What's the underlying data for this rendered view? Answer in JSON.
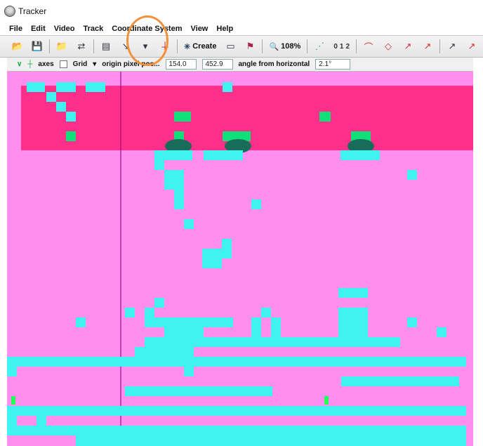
{
  "window": {
    "title": "Tracker"
  },
  "menu": [
    "File",
    "Edit",
    "Video",
    "Track",
    "Coordinate System",
    "View",
    "Help"
  ],
  "toolbar": {
    "create_label": "Create",
    "zoom_label": "108%",
    "step_label": "0",
    "step_sub": "1",
    "step_sub2": "2"
  },
  "coord_bar": {
    "axes_label": "axes",
    "grid_label": "Grid",
    "origin_label": "origin pixel pos...",
    "origin_x": "154.0",
    "origin_y": "452.9",
    "angle_label": "angle from horizontal",
    "angle_value": "2.1°"
  },
  "canvas": {
    "readout_left": "",
    "readout_right": ""
  },
  "colors": {
    "canvas": "#ff8ef0",
    "band": "#ff2f8a",
    "block": "#3ff3f0",
    "marker": "#10e07a",
    "highlight": "#f2913a"
  }
}
